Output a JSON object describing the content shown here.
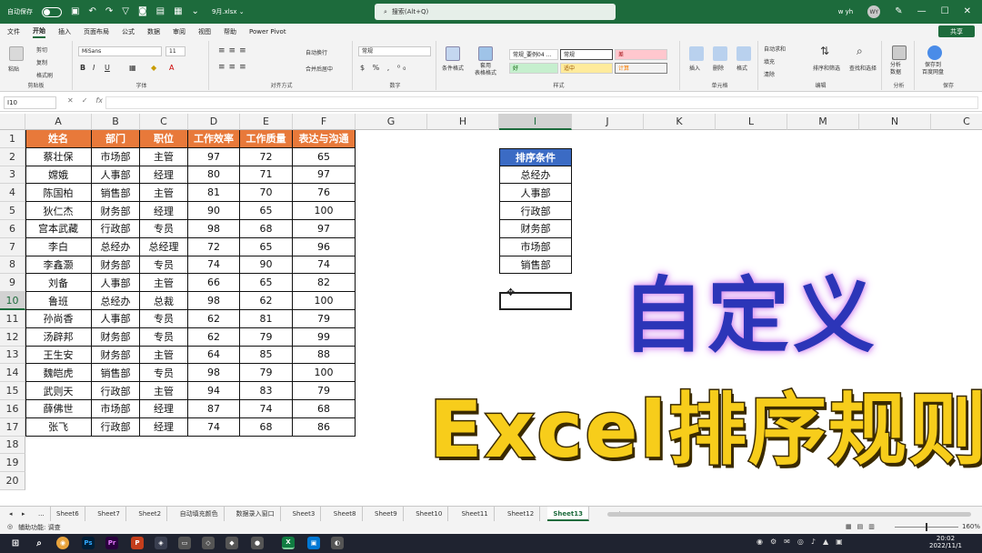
{
  "titlebar": {
    "autosave_label": "自动保存",
    "file_name": "9月.xlsx ⌄",
    "search_placeholder": "搜索(Alt+Q)",
    "user_name": "w yh",
    "avatar_initials": "WY"
  },
  "menubar": {
    "items": [
      "文件",
      "开始",
      "插入",
      "页面布局",
      "公式",
      "数据",
      "审阅",
      "视图",
      "帮助",
      "Power Pivot"
    ],
    "share_label": "共享"
  },
  "ribbon": {
    "clipboard": {
      "paste": "粘贴",
      "cut": "剪切",
      "copy": "复制",
      "format_painter": "格式刷",
      "label": "剪贴板"
    },
    "font": {
      "family": "MiSans",
      "size": "11",
      "label": "字体"
    },
    "alignment": {
      "wrap": "自动换行",
      "merge": "合并后居中",
      "label": "对齐方式"
    },
    "number": {
      "format": "常规",
      "label": "数字"
    },
    "styles": {
      "cond_format": "条件格式",
      "table_format": "套用\n表格格式",
      "cells": [
        "常规_要例04 ...",
        "常规",
        "差",
        "好",
        "适中",
        "计算"
      ],
      "label": "样式"
    },
    "cells_group": {
      "insert": "插入",
      "delete": "删除",
      "format": "格式",
      "label": "单元格"
    },
    "editing": {
      "autosum": "自动求和",
      "fill": "填充",
      "clear": "清除",
      "sort": "排序和筛选",
      "find": "查找和选择",
      "label": "编辑"
    },
    "analysis": {
      "analyze": "分析\n数据",
      "label": "分析"
    },
    "save": {
      "save_baidu": "保存到\n百度网盘",
      "label": "保存"
    }
  },
  "formula_bar": {
    "name_box": "I10",
    "value": ""
  },
  "columns": [
    "A",
    "B",
    "C",
    "D",
    "E",
    "F",
    "G",
    "H",
    "I",
    "J",
    "K",
    "L",
    "M",
    "N",
    "C"
  ],
  "rows": [
    "1",
    "2",
    "3",
    "4",
    "5",
    "6",
    "7",
    "8",
    "9",
    "10",
    "11",
    "12",
    "13",
    "14",
    "15",
    "16",
    "17",
    "18",
    "19",
    "20"
  ],
  "table": {
    "headers": [
      "姓名",
      "部门",
      "职位",
      "工作效率",
      "工作质量",
      "表达与沟通"
    ],
    "rows": [
      [
        "蔡壮保",
        "市场部",
        "主管",
        "97",
        "72",
        "65"
      ],
      [
        "嫦娥",
        "人事部",
        "经理",
        "80",
        "71",
        "97"
      ],
      [
        "陈国柏",
        "销售部",
        "主管",
        "81",
        "70",
        "76"
      ],
      [
        "狄仁杰",
        "财务部",
        "经理",
        "90",
        "65",
        "100"
      ],
      [
        "宫本武藏",
        "行政部",
        "专员",
        "98",
        "68",
        "97"
      ],
      [
        "李白",
        "总经办",
        "总经理",
        "72",
        "65",
        "96"
      ],
      [
        "李鑫灏",
        "财务部",
        "专员",
        "74",
        "90",
        "74"
      ],
      [
        "刘备",
        "人事部",
        "主管",
        "66",
        "65",
        "82"
      ],
      [
        "鲁班",
        "总经办",
        "总裁",
        "98",
        "62",
        "100"
      ],
      [
        "孙尚香",
        "人事部",
        "专员",
        "62",
        "81",
        "79"
      ],
      [
        "汤辟邦",
        "财务部",
        "专员",
        "62",
        "79",
        "99"
      ],
      [
        "王生安",
        "财务部",
        "主管",
        "64",
        "85",
        "88"
      ],
      [
        "魏皑虎",
        "销售部",
        "专员",
        "98",
        "79",
        "100"
      ],
      [
        "武则天",
        "行政部",
        "主管",
        "94",
        "83",
        "79"
      ],
      [
        "薛佛世",
        "市场部",
        "经理",
        "87",
        "74",
        "68"
      ],
      [
        "张飞",
        "行政部",
        "经理",
        "74",
        "68",
        "86"
      ]
    ]
  },
  "sort_conditions": {
    "header": "排序条件",
    "items": [
      "总经办",
      "人事部",
      "行政部",
      "财务部",
      "市场部",
      "销售部"
    ]
  },
  "overlay": {
    "line1": "自定义",
    "line2": "Excel排序规则"
  },
  "sheets": {
    "ellipsis": "...",
    "tabs": [
      "Sheet6",
      "Sheet7",
      "Sheet2",
      "自动填充颜色",
      "数据录入窗口",
      "Sheet3",
      "Sheet8",
      "Sheet9",
      "Sheet10",
      "Sheet11",
      "Sheet12",
      "Sheet13"
    ],
    "active": "Sheet13",
    "add": "+"
  },
  "status": {
    "text": "辅助功能: 调查",
    "zoom": "160%"
  },
  "taskbar": {
    "time": "20:02",
    "date": "2022/11/1"
  }
}
